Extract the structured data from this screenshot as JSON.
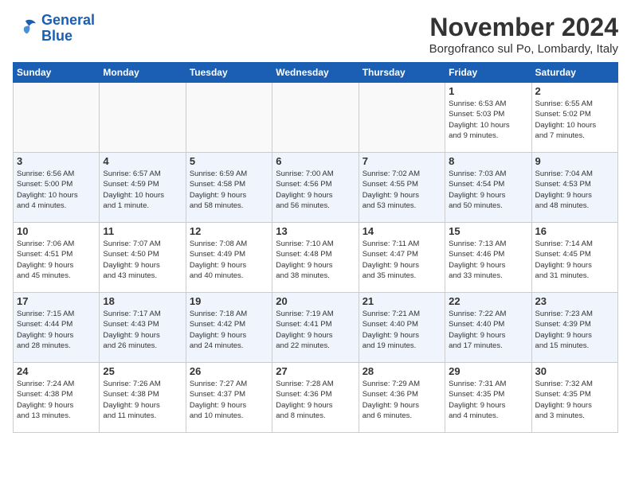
{
  "header": {
    "logo_line1": "General",
    "logo_line2": "Blue",
    "month": "November 2024",
    "location": "Borgofranco sul Po, Lombardy, Italy"
  },
  "weekdays": [
    "Sunday",
    "Monday",
    "Tuesday",
    "Wednesday",
    "Thursday",
    "Friday",
    "Saturday"
  ],
  "weeks": [
    [
      {
        "day": "",
        "info": ""
      },
      {
        "day": "",
        "info": ""
      },
      {
        "day": "",
        "info": ""
      },
      {
        "day": "",
        "info": ""
      },
      {
        "day": "",
        "info": ""
      },
      {
        "day": "1",
        "info": "Sunrise: 6:53 AM\nSunset: 5:03 PM\nDaylight: 10 hours\nand 9 minutes."
      },
      {
        "day": "2",
        "info": "Sunrise: 6:55 AM\nSunset: 5:02 PM\nDaylight: 10 hours\nand 7 minutes."
      }
    ],
    [
      {
        "day": "3",
        "info": "Sunrise: 6:56 AM\nSunset: 5:00 PM\nDaylight: 10 hours\nand 4 minutes."
      },
      {
        "day": "4",
        "info": "Sunrise: 6:57 AM\nSunset: 4:59 PM\nDaylight: 10 hours\nand 1 minute."
      },
      {
        "day": "5",
        "info": "Sunrise: 6:59 AM\nSunset: 4:58 PM\nDaylight: 9 hours\nand 58 minutes."
      },
      {
        "day": "6",
        "info": "Sunrise: 7:00 AM\nSunset: 4:56 PM\nDaylight: 9 hours\nand 56 minutes."
      },
      {
        "day": "7",
        "info": "Sunrise: 7:02 AM\nSunset: 4:55 PM\nDaylight: 9 hours\nand 53 minutes."
      },
      {
        "day": "8",
        "info": "Sunrise: 7:03 AM\nSunset: 4:54 PM\nDaylight: 9 hours\nand 50 minutes."
      },
      {
        "day": "9",
        "info": "Sunrise: 7:04 AM\nSunset: 4:53 PM\nDaylight: 9 hours\nand 48 minutes."
      }
    ],
    [
      {
        "day": "10",
        "info": "Sunrise: 7:06 AM\nSunset: 4:51 PM\nDaylight: 9 hours\nand 45 minutes."
      },
      {
        "day": "11",
        "info": "Sunrise: 7:07 AM\nSunset: 4:50 PM\nDaylight: 9 hours\nand 43 minutes."
      },
      {
        "day": "12",
        "info": "Sunrise: 7:08 AM\nSunset: 4:49 PM\nDaylight: 9 hours\nand 40 minutes."
      },
      {
        "day": "13",
        "info": "Sunrise: 7:10 AM\nSunset: 4:48 PM\nDaylight: 9 hours\nand 38 minutes."
      },
      {
        "day": "14",
        "info": "Sunrise: 7:11 AM\nSunset: 4:47 PM\nDaylight: 9 hours\nand 35 minutes."
      },
      {
        "day": "15",
        "info": "Sunrise: 7:13 AM\nSunset: 4:46 PM\nDaylight: 9 hours\nand 33 minutes."
      },
      {
        "day": "16",
        "info": "Sunrise: 7:14 AM\nSunset: 4:45 PM\nDaylight: 9 hours\nand 31 minutes."
      }
    ],
    [
      {
        "day": "17",
        "info": "Sunrise: 7:15 AM\nSunset: 4:44 PM\nDaylight: 9 hours\nand 28 minutes."
      },
      {
        "day": "18",
        "info": "Sunrise: 7:17 AM\nSunset: 4:43 PM\nDaylight: 9 hours\nand 26 minutes."
      },
      {
        "day": "19",
        "info": "Sunrise: 7:18 AM\nSunset: 4:42 PM\nDaylight: 9 hours\nand 24 minutes."
      },
      {
        "day": "20",
        "info": "Sunrise: 7:19 AM\nSunset: 4:41 PM\nDaylight: 9 hours\nand 22 minutes."
      },
      {
        "day": "21",
        "info": "Sunrise: 7:21 AM\nSunset: 4:40 PM\nDaylight: 9 hours\nand 19 minutes."
      },
      {
        "day": "22",
        "info": "Sunrise: 7:22 AM\nSunset: 4:40 PM\nDaylight: 9 hours\nand 17 minutes."
      },
      {
        "day": "23",
        "info": "Sunrise: 7:23 AM\nSunset: 4:39 PM\nDaylight: 9 hours\nand 15 minutes."
      }
    ],
    [
      {
        "day": "24",
        "info": "Sunrise: 7:24 AM\nSunset: 4:38 PM\nDaylight: 9 hours\nand 13 minutes."
      },
      {
        "day": "25",
        "info": "Sunrise: 7:26 AM\nSunset: 4:38 PM\nDaylight: 9 hours\nand 11 minutes."
      },
      {
        "day": "26",
        "info": "Sunrise: 7:27 AM\nSunset: 4:37 PM\nDaylight: 9 hours\nand 10 minutes."
      },
      {
        "day": "27",
        "info": "Sunrise: 7:28 AM\nSunset: 4:36 PM\nDaylight: 9 hours\nand 8 minutes."
      },
      {
        "day": "28",
        "info": "Sunrise: 7:29 AM\nSunset: 4:36 PM\nDaylight: 9 hours\nand 6 minutes."
      },
      {
        "day": "29",
        "info": "Sunrise: 7:31 AM\nSunset: 4:35 PM\nDaylight: 9 hours\nand 4 minutes."
      },
      {
        "day": "30",
        "info": "Sunrise: 7:32 AM\nSunset: 4:35 PM\nDaylight: 9 hours\nand 3 minutes."
      }
    ]
  ]
}
